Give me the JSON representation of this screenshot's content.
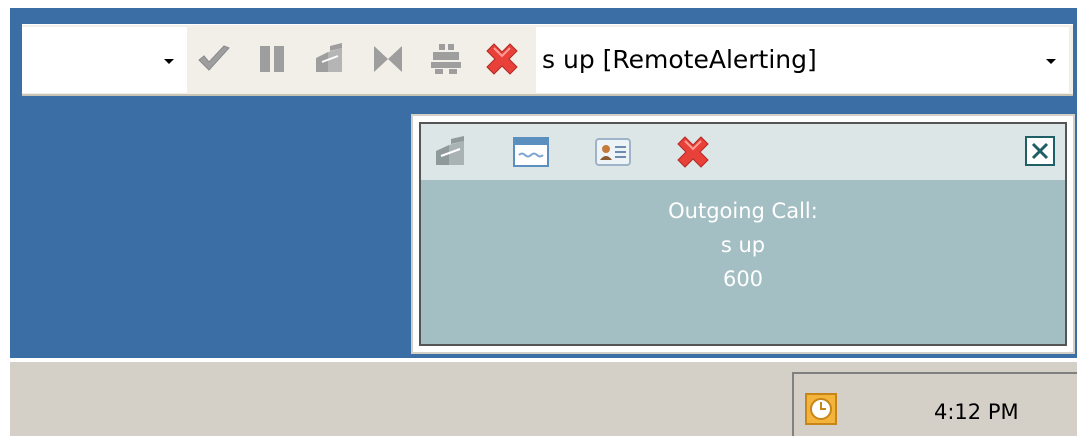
{
  "toolbar": {
    "call_combo_text": "s up [RemoteAlerting]",
    "icons": [
      "answer-icon",
      "hold-icon",
      "transfer-icon",
      "conference-icon",
      "keypad-icon",
      "hangup-icon"
    ]
  },
  "popup": {
    "icons": [
      "transfer-icon",
      "window-icon",
      "contact-card-icon",
      "hangup-icon",
      "close-icon"
    ],
    "lines": [
      "Outgoing Call:",
      "s up",
      "600"
    ]
  },
  "taskbar": {
    "clock": "4:12 PM"
  },
  "colors": {
    "desktop": "#3a6ea5",
    "popup_body": "#a3bfc3",
    "popup_header": "#dde6e7",
    "hangup_red": "#e8413a",
    "taskbar": "#d4d0c8"
  }
}
